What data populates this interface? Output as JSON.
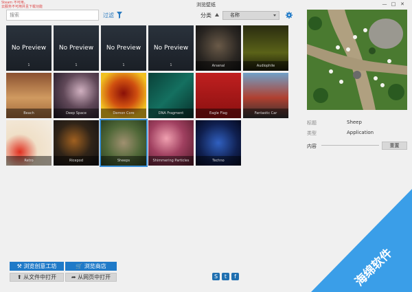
{
  "window": {
    "title": "浏览壁纸",
    "steam_warning_1": "Steam 不可用。",
    "steam_warning_2": "云服务不可用并且下载功能"
  },
  "toolbar": {
    "search_placeholder": "搜索",
    "filter_label": "过滤",
    "sort_label": "分类",
    "sort_value": "名称"
  },
  "tiles": [
    {
      "label": "1",
      "no_preview": "No Preview"
    },
    {
      "label": "1",
      "no_preview": "No Preview"
    },
    {
      "label": "1",
      "no_preview": "No Preview"
    },
    {
      "label": "1",
      "no_preview": "No Preview"
    },
    {
      "label": "Arsenal"
    },
    {
      "label": "Audiophile"
    },
    {
      "label": "Beach"
    },
    {
      "label": "Deep Space"
    },
    {
      "label": "Demon Core"
    },
    {
      "label": "DNA Fragment"
    },
    {
      "label": "Eagle Flag"
    },
    {
      "label": "Fantastic Car"
    },
    {
      "label": "Retro"
    },
    {
      "label": "Ricepod"
    },
    {
      "label": "Sheeps"
    },
    {
      "label": "Shimmering Particles"
    },
    {
      "label": "Techno"
    }
  ],
  "details": {
    "title_key": "标题",
    "title_value": "Sheep",
    "type_key": "类型",
    "type_value": "Application",
    "content_key": "内容",
    "reset_label": "重置"
  },
  "bottom": {
    "workshop": "浏览创意工坊",
    "store": "浏览商店",
    "open_file": "从文件中打开",
    "open_web": "从网页中打开"
  },
  "watermark": {
    "text": "海绵软件"
  },
  "colors": {
    "accent": "#1f7ac8",
    "watermark": "#3a9ee8"
  }
}
